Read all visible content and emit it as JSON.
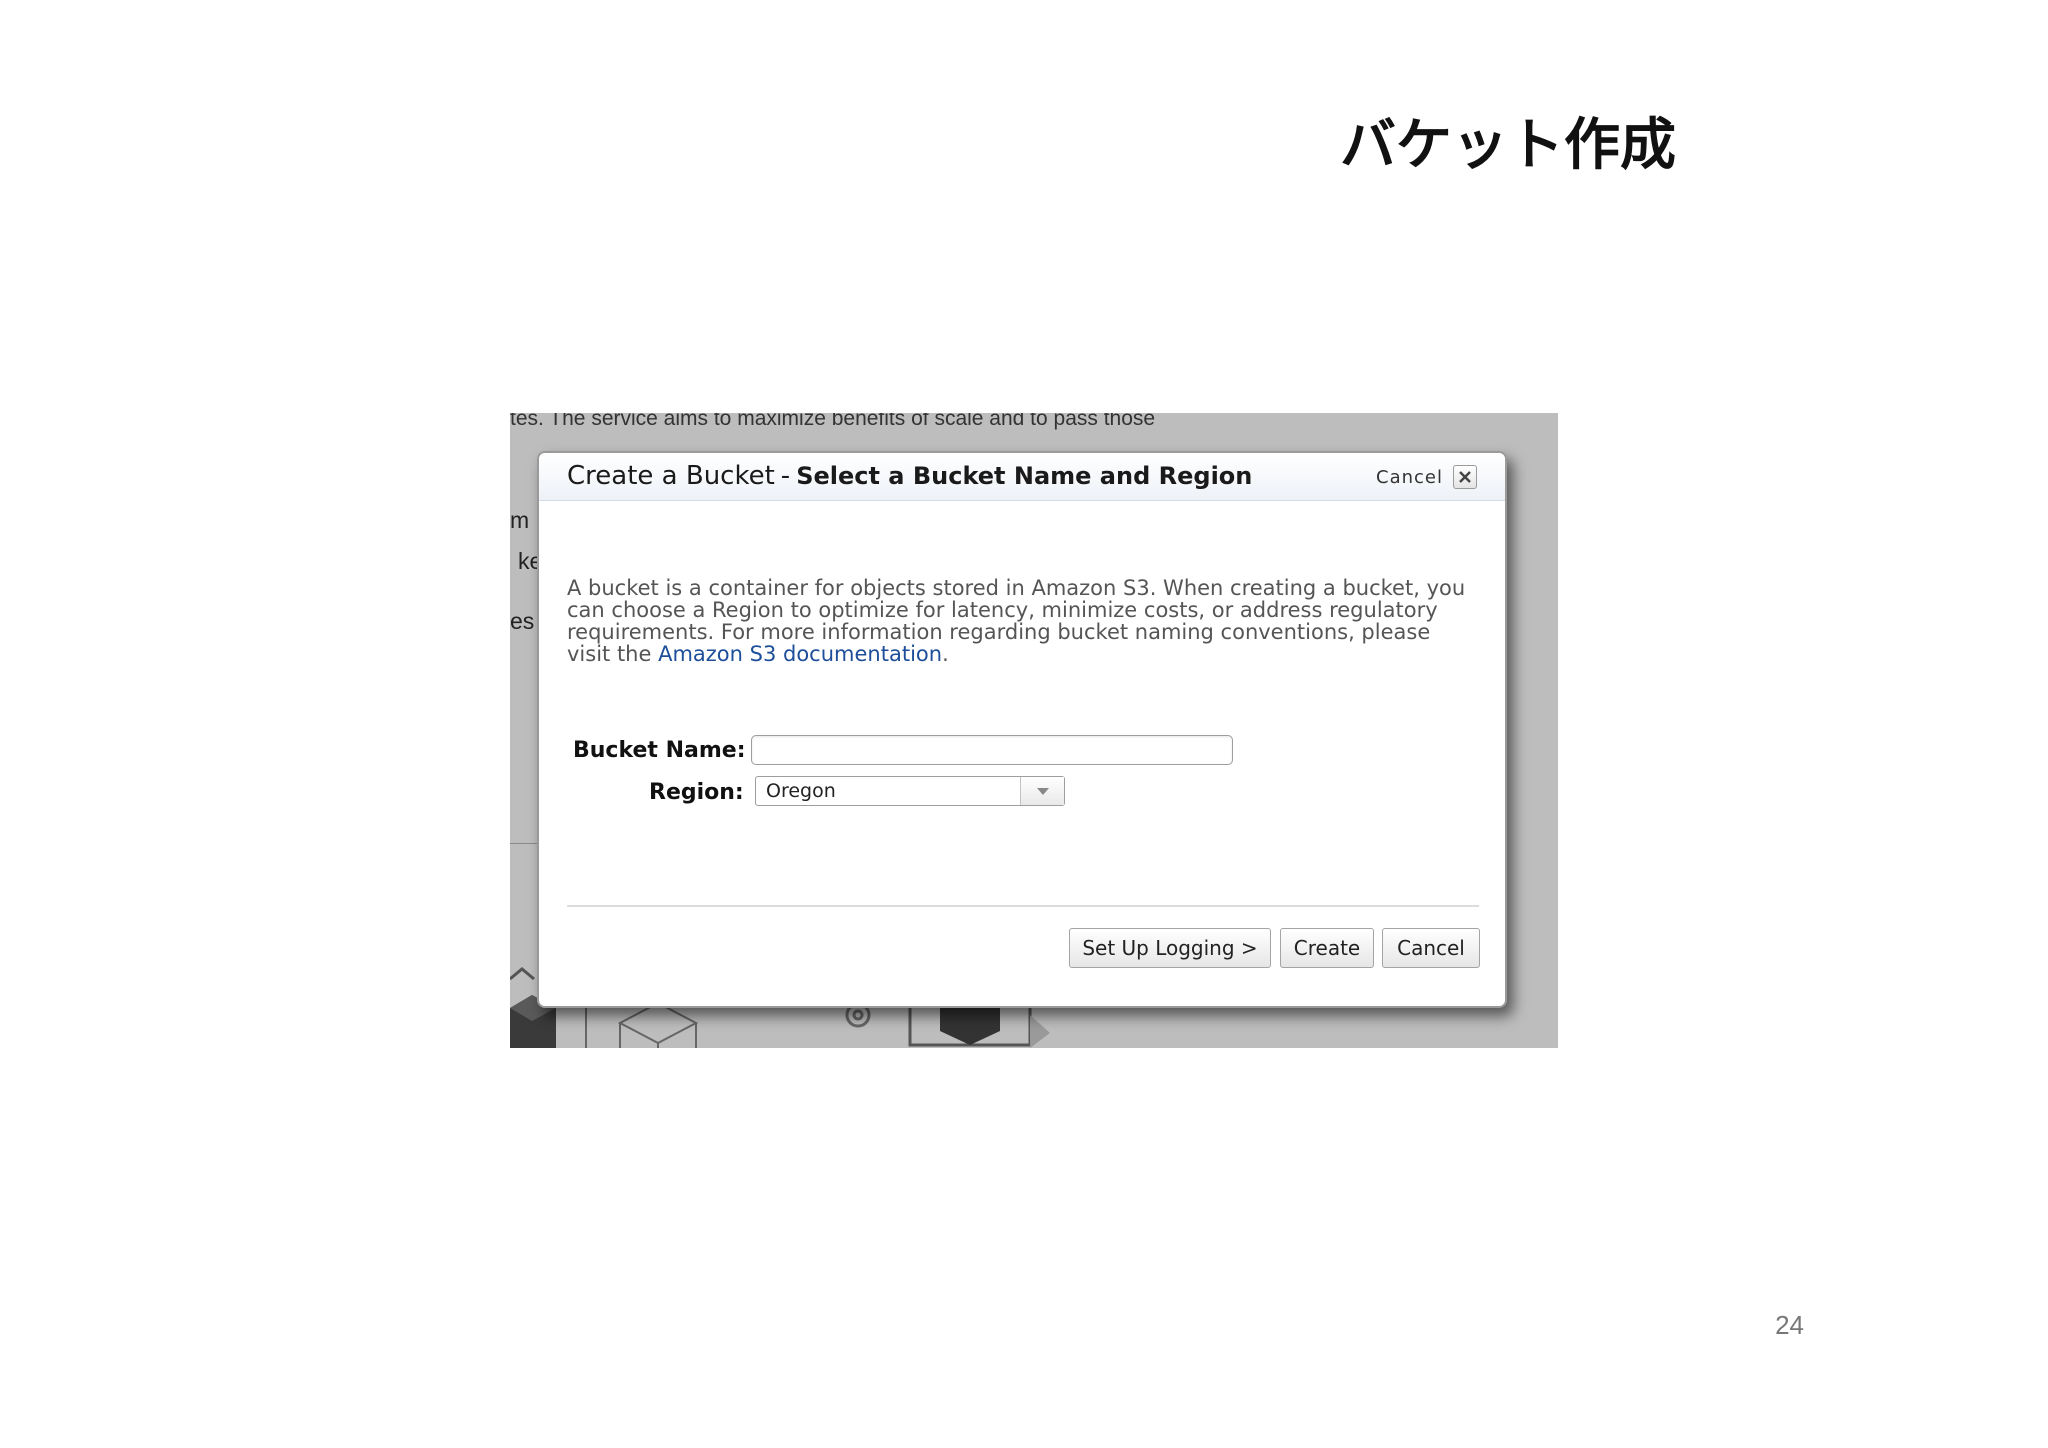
{
  "slide": {
    "title": "バケット作成",
    "page_number": "24"
  },
  "background": {
    "top_text": "tes. The service aims to maximize benefits of scale and to pass those",
    "fragment_1": "m",
    "fragment_2": "ke",
    "fragment_3": "es"
  },
  "dialog": {
    "title": "Create a Bucket",
    "separator": "-",
    "subtitle": "Select a Bucket Name and Region",
    "header_cancel": "Cancel",
    "description": "A bucket is a container for objects stored in Amazon S3. When creating a bucket, you can choose a Region to optimize for latency, minimize costs, or address regulatory requirements. For more information regarding bucket naming conventions, please visit the ",
    "doc_link": "Amazon S3 documentation",
    "description_end": ".",
    "bucket_name_label": "Bucket Name:",
    "bucket_name_value": "",
    "region_label": "Region:",
    "region_value": "Oregon",
    "buttons": {
      "logging": "Set Up Logging >",
      "create": "Create",
      "cancel": "Cancel"
    }
  },
  "colors": {
    "link": "#1d4e9a",
    "overlay": "#bdbdbd"
  },
  "icons": [
    "close-icon",
    "dropdown-arrow-icon",
    "cube-icon",
    "gear-icon"
  ]
}
